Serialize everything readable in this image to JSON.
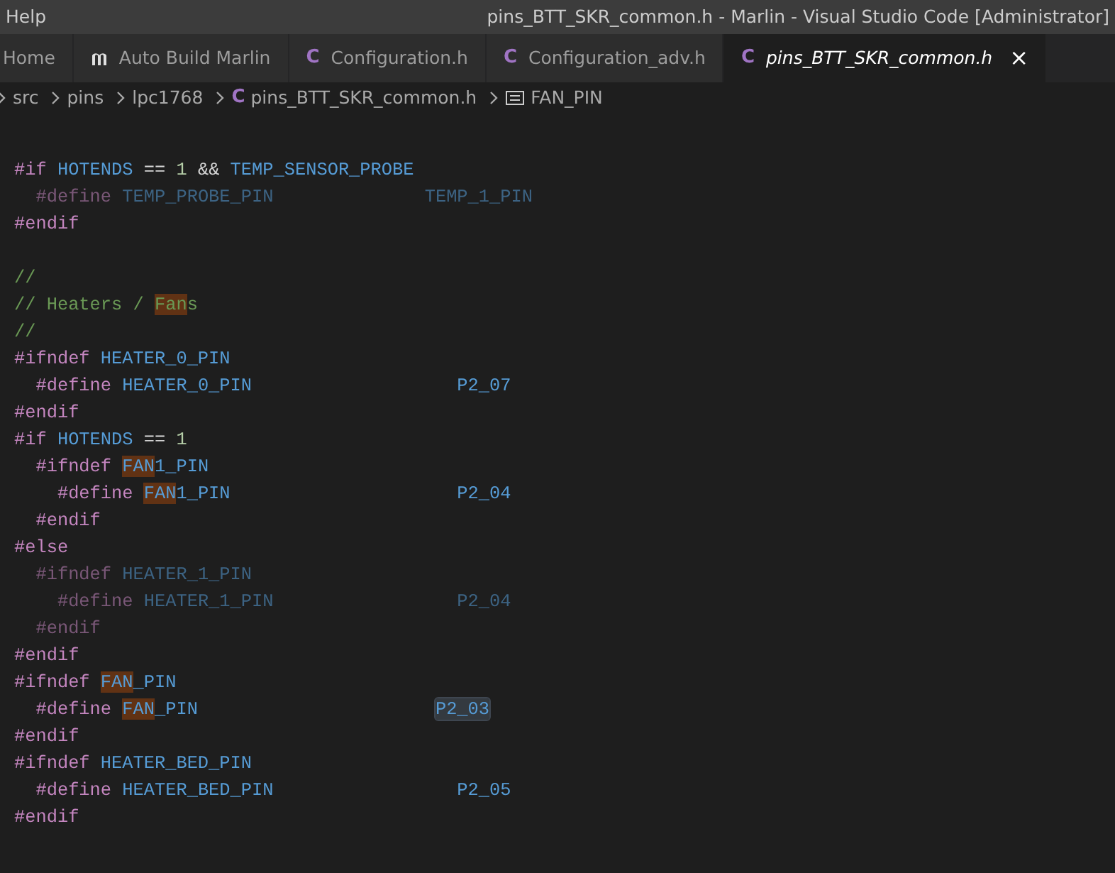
{
  "menu": [
    {
      "label": "Help"
    }
  ],
  "window": {
    "title": "pins_BTT_SKR_common.h - Marlin - Visual Studio Code [Administrator]"
  },
  "tabs": [
    {
      "label": "Home",
      "selected": false,
      "italic": false
    },
    {
      "label": "Auto Build Marlin",
      "selected": false,
      "italic": false,
      "icon": {
        "kind": "logo"
      }
    },
    {
      "label": "Configuration.h",
      "selected": false,
      "italic": false,
      "icon": {
        "kind": "letter",
        "text": "C"
      }
    },
    {
      "label": "Configuration_adv.h",
      "selected": false,
      "italic": false,
      "icon": {
        "kind": "letter",
        "text": "C"
      }
    },
    {
      "label": "pins_BTT_SKR_common.h",
      "selected": true,
      "italic": true,
      "icon": {
        "kind": "letter",
        "text": "C"
      },
      "close": "×"
    }
  ],
  "breadcrumbs": [
    {
      "label": "src"
    },
    {
      "label": "pins"
    },
    {
      "label": "lpc1768"
    },
    {
      "label": "pins_BTT_SKR_common.h",
      "icon": {
        "kind": "letter",
        "text": "C"
      }
    },
    {
      "label": "FAN_PIN",
      "icon": {
        "kind": "symbol"
      }
    }
  ],
  "code": [
    {
      "dimmed": false,
      "blank_before": false,
      "tokens": [
        {
          "t": "#if",
          "kind": "directive"
        },
        {
          "t": " HOTENDS",
          "kind": "macro"
        },
        {
          "t": " ==",
          "kind": "op"
        },
        {
          "t": " 1",
          "kind": "number"
        },
        {
          "t": " &&",
          "kind": "op"
        },
        {
          "t": " TEMP_SENSOR_PROBE",
          "kind": "macro"
        }
      ]
    },
    {
      "dimmed": true,
      "blank_before": false,
      "tokens": [
        {
          "t": "  #define",
          "kind": "directive"
        },
        {
          "t": " TEMP_PROBE_PIN",
          "kind": "macro"
        },
        {
          "t": "              TEMP_1_PIN",
          "kind": "macro"
        }
      ]
    },
    {
      "dimmed": false,
      "blank_before": false,
      "tokens": [
        {
          "t": "#endif",
          "kind": "directive"
        }
      ]
    },
    {
      "dimmed": false,
      "blank_before": true,
      "tokens": [
        {
          "t": "//",
          "kind": "comment"
        }
      ]
    },
    {
      "dimmed": false,
      "blank_before": false,
      "tokens": [
        {
          "t": "// Heaters / ",
          "kind": "comment"
        },
        {
          "t": "Fan",
          "kind": "comment",
          "match": true
        },
        {
          "t": "s",
          "kind": "comment"
        }
      ]
    },
    {
      "dimmed": false,
      "blank_before": false,
      "tokens": [
        {
          "t": "//",
          "kind": "comment"
        }
      ]
    },
    {
      "dimmed": false,
      "blank_before": false,
      "tokens": [
        {
          "t": "#ifndef",
          "kind": "directive"
        },
        {
          "t": " HEATER_0_PIN",
          "kind": "macro"
        }
      ]
    },
    {
      "dimmed": false,
      "blank_before": false,
      "tokens": [
        {
          "t": "  #define",
          "kind": "directive"
        },
        {
          "t": " HEATER_0_PIN",
          "kind": "macro"
        },
        {
          "t": "                   P2_07",
          "kind": "macro"
        }
      ]
    },
    {
      "dimmed": false,
      "blank_before": false,
      "tokens": [
        {
          "t": "#endif",
          "kind": "directive"
        }
      ]
    },
    {
      "dimmed": false,
      "blank_before": false,
      "tokens": [
        {
          "t": "#if",
          "kind": "directive"
        },
        {
          "t": " HOTENDS",
          "kind": "macro"
        },
        {
          "t": " ==",
          "kind": "op"
        },
        {
          "t": " 1",
          "kind": "number"
        }
      ]
    },
    {
      "dimmed": false,
      "blank_before": false,
      "tokens": [
        {
          "t": "  #ifndef ",
          "kind": "directive"
        },
        {
          "t": "FAN",
          "kind": "macro",
          "match": true
        },
        {
          "t": "1_PIN",
          "kind": "macro"
        }
      ]
    },
    {
      "dimmed": false,
      "blank_before": false,
      "tokens": [
        {
          "t": "    #define ",
          "kind": "directive"
        },
        {
          "t": "FAN",
          "kind": "macro",
          "match": true
        },
        {
          "t": "1_PIN",
          "kind": "macro"
        },
        {
          "t": "                     P2_04",
          "kind": "macro"
        }
      ]
    },
    {
      "dimmed": false,
      "blank_before": false,
      "tokens": [
        {
          "t": "  #endif",
          "kind": "directive"
        }
      ]
    },
    {
      "dimmed": false,
      "blank_before": false,
      "tokens": [
        {
          "t": "#else",
          "kind": "directive"
        }
      ]
    },
    {
      "dimmed": true,
      "blank_before": false,
      "tokens": [
        {
          "t": "  #ifndef",
          "kind": "directive"
        },
        {
          "t": " HEATER_1_PIN",
          "kind": "macro"
        }
      ]
    },
    {
      "dimmed": true,
      "blank_before": false,
      "tokens": [
        {
          "t": "    #define",
          "kind": "directive"
        },
        {
          "t": " HEATER_1_PIN",
          "kind": "macro"
        },
        {
          "t": "                 P2_04",
          "kind": "macro"
        }
      ]
    },
    {
      "dimmed": true,
      "blank_before": false,
      "tokens": [
        {
          "t": "  #endif",
          "kind": "directive"
        }
      ]
    },
    {
      "dimmed": false,
      "blank_before": false,
      "tokens": [
        {
          "t": "#endif",
          "kind": "directive"
        }
      ]
    },
    {
      "dimmed": false,
      "blank_before": false,
      "tokens": [
        {
          "t": "#ifndef ",
          "kind": "directive"
        },
        {
          "t": "FAN",
          "kind": "macro",
          "match": true
        },
        {
          "t": "_PIN",
          "kind": "macro"
        }
      ]
    },
    {
      "dimmed": false,
      "blank_before": false,
      "tokens": [
        {
          "t": "  #define ",
          "kind": "directive"
        },
        {
          "t": "FAN",
          "kind": "macro",
          "match": true
        },
        {
          "t": "_PIN                      ",
          "kind": "macro"
        },
        {
          "t": "P2_03",
          "kind": "macro",
          "occurrence": true
        }
      ]
    },
    {
      "dimmed": false,
      "blank_before": false,
      "tokens": [
        {
          "t": "#endif",
          "kind": "directive"
        }
      ]
    },
    {
      "dimmed": false,
      "blank_before": false,
      "tokens": [
        {
          "t": "#ifndef",
          "kind": "directive"
        },
        {
          "t": " HEATER_BED_PIN",
          "kind": "macro"
        }
      ]
    },
    {
      "dimmed": false,
      "blank_before": false,
      "tokens": [
        {
          "t": "  #define",
          "kind": "directive"
        },
        {
          "t": " HEATER_BED_PIN",
          "kind": "macro"
        },
        {
          "t": "                 P2_05",
          "kind": "macro"
        }
      ]
    },
    {
      "dimmed": false,
      "blank_before": false,
      "tokens": [
        {
          "t": "#endif",
          "kind": "directive"
        }
      ]
    }
  ]
}
